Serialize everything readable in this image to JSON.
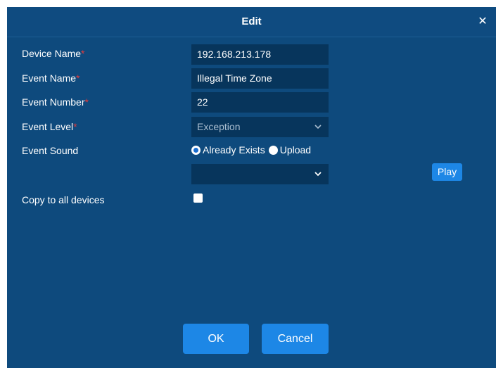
{
  "dialog": {
    "title": "Edit",
    "close_icon": "close-icon"
  },
  "form": {
    "device_name": {
      "label": "Device Name",
      "required": "*",
      "value": "192.168.213.178"
    },
    "event_name": {
      "label": "Event Name",
      "required": "*",
      "value": "Illegal Time Zone"
    },
    "event_number": {
      "label": "Event Number",
      "required": "*",
      "value": "22"
    },
    "event_level": {
      "label": "Event Level",
      "required": "*",
      "value": "Exception"
    },
    "event_sound": {
      "label": "Event Sound",
      "options": [
        {
          "label": "Already Exists",
          "checked": true
        },
        {
          "label": "Upload",
          "checked": false
        }
      ],
      "sound_select_value": "",
      "play_label": "Play"
    },
    "copy_to_all": {
      "label": "Copy to all devices",
      "checked": false
    }
  },
  "buttons": {
    "ok": "OK",
    "cancel": "Cancel"
  },
  "colors": {
    "dialog_bg": "#0e4a7d",
    "field_bg": "#07355c",
    "accent": "#1d87e6",
    "required": "#e23b3b"
  }
}
